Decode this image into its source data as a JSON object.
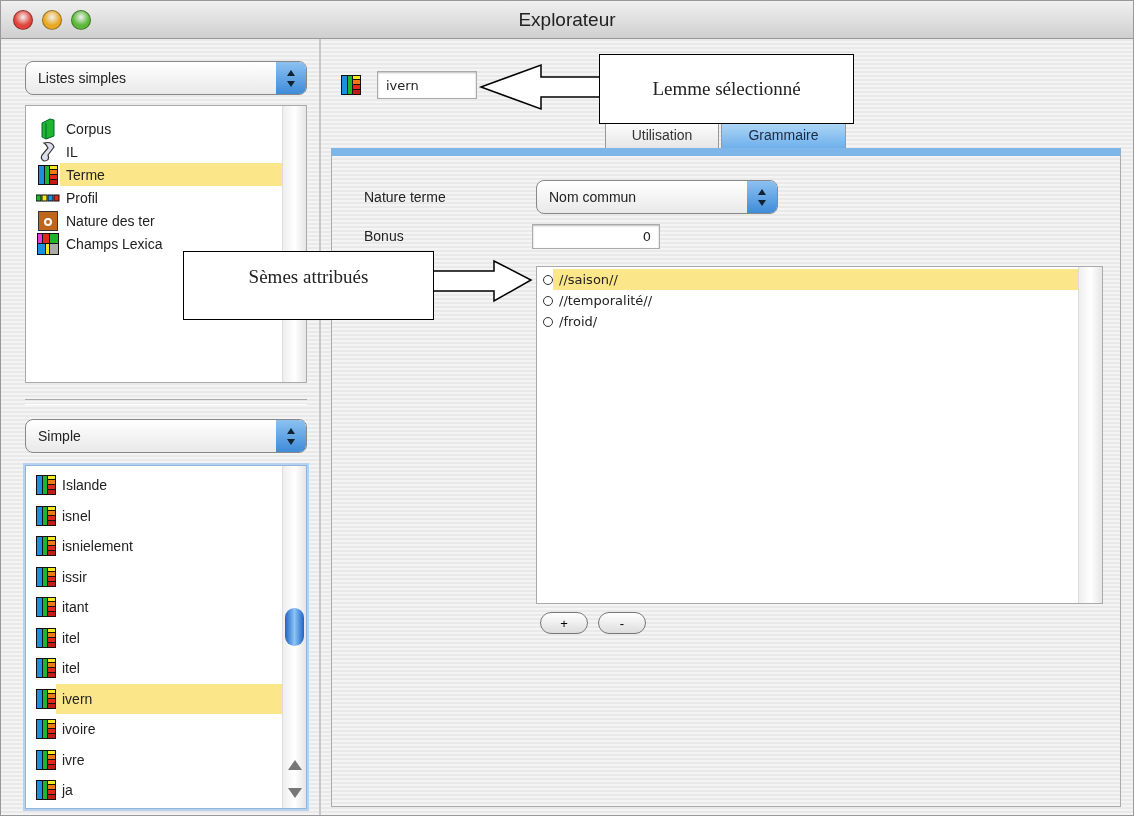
{
  "window": {
    "title": "Explorateur"
  },
  "left": {
    "top_popup": "Listes simples",
    "categories": [
      {
        "label": "Corpus",
        "kind": "corpus",
        "selected": false
      },
      {
        "label": "IL",
        "kind": "scroll",
        "selected": false
      },
      {
        "label": "Terme",
        "kind": "terme",
        "selected": true
      },
      {
        "label": "Profil",
        "kind": "profil",
        "selected": false
      },
      {
        "label": "Nature des ter",
        "kind": "nature",
        "selected": false
      },
      {
        "label": "Champs Lexica",
        "kind": "champs",
        "selected": false
      }
    ],
    "bottom_popup": "Simple",
    "terms": [
      {
        "label": "Islande",
        "selected": false
      },
      {
        "label": "isnel",
        "selected": false
      },
      {
        "label": "isnielement",
        "selected": false
      },
      {
        "label": "issir",
        "selected": false
      },
      {
        "label": "itant",
        "selected": false
      },
      {
        "label": "itel",
        "selected": false
      },
      {
        "label": "itel",
        "selected": false
      },
      {
        "label": "ivern",
        "selected": true
      },
      {
        "label": "ivoire",
        "selected": false
      },
      {
        "label": "ivre",
        "selected": false
      },
      {
        "label": "ja",
        "selected": false
      }
    ]
  },
  "lemma": {
    "value": "ivern"
  },
  "tabs": [
    {
      "label": "Utilisation",
      "selected": false
    },
    {
      "label": "Grammaire",
      "selected": true
    }
  ],
  "form": {
    "nature_label": "Nature terme",
    "nature_value": "Nom commun",
    "bonus_label": "Bonus",
    "bonus_value": "0",
    "semes": [
      {
        "label": "//saison//",
        "selected": true
      },
      {
        "label": "//temporalité//",
        "selected": false
      },
      {
        "label": "/froid/",
        "selected": false
      }
    ],
    "buttons": [
      "+",
      "-"
    ]
  },
  "callouts": [
    {
      "text": "Lemme sélectionné"
    },
    {
      "text": "Sèmes attribués"
    }
  ]
}
